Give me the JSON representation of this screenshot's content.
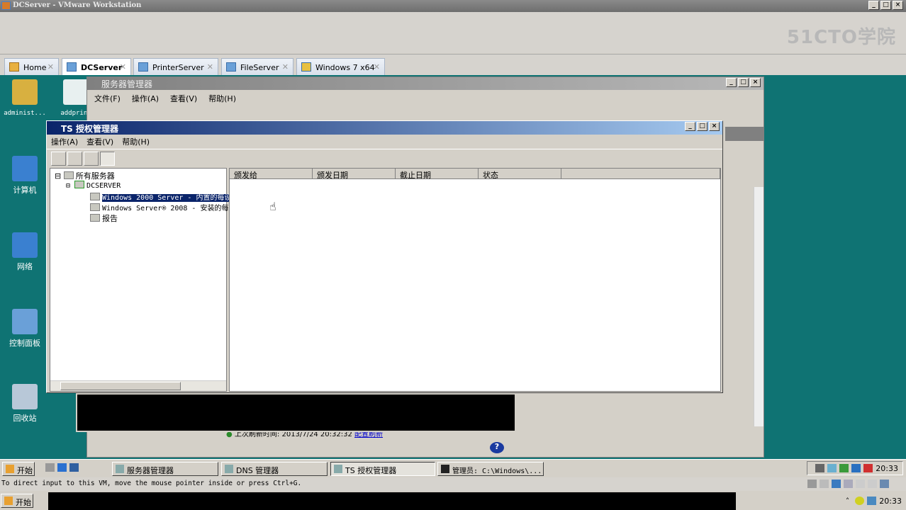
{
  "window": {
    "title": "DCServer - VMware Workstation"
  },
  "watermark": "51CTO学院",
  "tabs": [
    {
      "label": "Home"
    },
    {
      "label": "DCServer",
      "active": true
    },
    {
      "label": "PrinterServer"
    },
    {
      "label": "FileServer"
    },
    {
      "label": "Windows 7 x64"
    }
  ],
  "desktop_icons": [
    {
      "label": "administ..."
    },
    {
      "label": "addprint"
    },
    {
      "label": "计算机"
    },
    {
      "label": "网络"
    },
    {
      "label": "控制面板"
    },
    {
      "label": "回收站"
    }
  ],
  "server_manager": {
    "title": "服务器管理器",
    "menu": [
      "文件(F)",
      "操作(A)",
      "查看(V)",
      "帮助(H)"
    ],
    "status_text": "上次刷新时间: 2013/7/24 20:32:32",
    "refresh_link": "配置刷新"
  },
  "ts": {
    "title": "TS 授权管理器",
    "menu": [
      "操作(A)",
      "查看(V)",
      "帮助(H)"
    ],
    "tree": {
      "root": "所有服务器",
      "server": "DCSERVER",
      "children": [
        "Windows 2000 Server - 内置的每设",
        "Windows Server® 2008 - 安装的每",
        "报告"
      ]
    },
    "columns": [
      "颁发给",
      "颁发日期",
      "截止日期",
      "状态"
    ]
  },
  "vm_taskbar": {
    "start": "开始",
    "items": [
      "服务器管理器",
      "DNS 管理器",
      "TS 授权管理器",
      "管理员: C:\\Windows\\..."
    ],
    "clock": "20:33"
  },
  "status_line": "To direct input to this VM, move the mouse pointer inside or press Ctrl+G.",
  "host_taskbar": {
    "start": "开始",
    "clock": "20:33"
  }
}
